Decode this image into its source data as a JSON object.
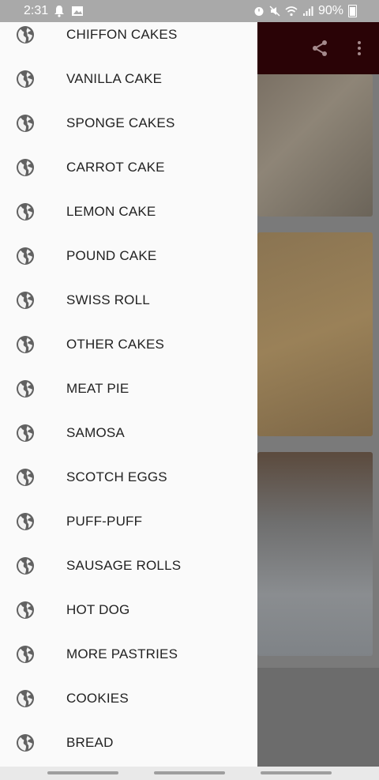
{
  "status_bar": {
    "time": "2:31",
    "battery": "90%",
    "left_icons": [
      "bell-icon",
      "image-icon"
    ],
    "right_icons": [
      "alarm-icon",
      "mute-icon",
      "wifi-icon",
      "signal-icon",
      "battery-icon"
    ]
  },
  "toolbar": {
    "actions": [
      "share-icon",
      "more-vert-icon"
    ]
  },
  "drawer": {
    "item_icon": "globe-icon",
    "items": [
      {
        "label": "CHIFFON CAKES"
      },
      {
        "label": "VANILLA CAKE"
      },
      {
        "label": "SPONGE CAKES"
      },
      {
        "label": "CARROT CAKE"
      },
      {
        "label": "LEMON CAKE"
      },
      {
        "label": "POUND CAKE"
      },
      {
        "label": "SWISS ROLL"
      },
      {
        "label": "OTHER CAKES"
      },
      {
        "label": "MEAT PIE"
      },
      {
        "label": "SAMOSA"
      },
      {
        "label": "SCOTCH EGGS"
      },
      {
        "label": "PUFF-PUFF"
      },
      {
        "label": "SAUSAGE ROLLS"
      },
      {
        "label": "HOT DOG"
      },
      {
        "label": "MORE PASTRIES"
      },
      {
        "label": "COOKIES"
      },
      {
        "label": "BREAD"
      }
    ]
  },
  "colors": {
    "toolbar": "#2a0306",
    "drawer_bg": "#fafafa",
    "icon": "#616161",
    "text": "#222222"
  }
}
